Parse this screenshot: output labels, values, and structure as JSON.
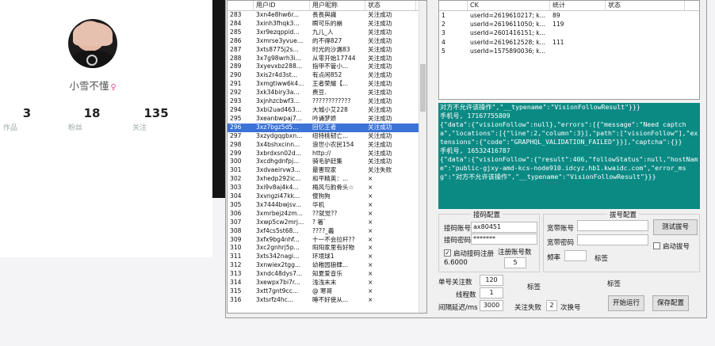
{
  "profile": {
    "username": "小雪不懂",
    "gender_symbol": "♀",
    "stats": [
      {
        "value": "3",
        "label": "作品"
      },
      {
        "value": "18",
        "label": "粉丝"
      },
      {
        "value": "135",
        "label": "关注"
      }
    ]
  },
  "left_table": {
    "columns": [
      "",
      "用户ID",
      "用户昵称",
      "状态"
    ],
    "rows": [
      [
        "283",
        "3xn4e8hw6r...",
        "長長與識",
        "关注成功"
      ],
      [
        "284",
        "3xinh3fhqk3...",
        "瞬可乐的崩",
        "关注成功"
      ],
      [
        "285",
        "3xr9ezqppid...",
        "九儿_人",
        "关注成功"
      ],
      [
        "286",
        "3xmrse3yvue...",
        "的不得827",
        "关注成功"
      ],
      [
        "287",
        "3xts8775j2s...",
        "时光的沙漏83",
        "关注成功"
      ],
      [
        "288",
        "3x7g98wrh3i...",
        "从零开始17744",
        "关注成功"
      ],
      [
        "289",
        "3xyevxbz288...",
        "指甲不管小...",
        "关注成功"
      ],
      [
        "290",
        "3xis2r4d3st...",
        "有点闲852",
        "关注成功"
      ],
      [
        "291",
        "3xmgtiww6k4...",
        "王者荣耀【...",
        "关注成功"
      ],
      [
        "292",
        "3xk34biry3a...",
        "费豆.",
        "关注成功"
      ],
      [
        "293",
        "3xjnhzcbwf3...",
        "????????????",
        "关注成功"
      ],
      [
        "294",
        "3xbi2uad463...",
        "大城小艾228",
        "关注成功"
      ],
      [
        "295",
        "3xeanbwpaj7...",
        "吟诵梦娇",
        "关注成功"
      ],
      [
        "296",
        "3xz7bgz5d5...",
        "回忆王者",
        "关注成功"
      ],
      [
        "297",
        "3xzydgqgbxn...",
        "纽特桃韧亡...",
        "关注成功"
      ],
      [
        "298",
        "3x4bshxcinn...",
        "浪世小农民154",
        "关注成功"
      ],
      [
        "299",
        "3xbrdxsn02d...",
        "http://",
        "关注成功"
      ],
      [
        "300",
        "3xcdhgdnfpj...",
        "骑毛驴赶集",
        "关注成功"
      ],
      [
        "301",
        "3xdvaeirvw3...",
        "最害现家",
        "关注失败"
      ],
      [
        "302",
        "3xhedp292ic...",
        "和平精英：...",
        "×"
      ],
      [
        "303",
        "3xi9v8aj4k4...",
        "梅风与韵骨头☆",
        "×"
      ],
      [
        "304",
        "3xvngzi47kk...",
        "傻狗狗",
        "×"
      ],
      [
        "305",
        "3x7444bwjsv...",
        "华机",
        "×"
      ],
      [
        "306",
        "3xmrbejz4zm...",
        "??就觉??",
        "×"
      ],
      [
        "307",
        "3xwp5cw2mrj...",
        "?  箸`",
        "×"
      ],
      [
        "308",
        "3xf4cs5st68...",
        "????_義",
        "×"
      ],
      [
        "309",
        "3xfx9bg4nhf...",
        "十一不会拉杆??",
        "×"
      ],
      [
        "310",
        "3xc2gnhrj5p...",
        "阳阳家里有好物",
        "×"
      ],
      [
        "311",
        "3xts342nagi...",
        "环境球1",
        "×"
      ],
      [
        "312",
        "3xnwiex2tgg...",
        "幼稚园狼肆...",
        "×"
      ],
      [
        "313",
        "3xndc48dys7...",
        "知夏爱音乐",
        "×"
      ],
      [
        "314",
        "3xewpx7bi7r...",
        "浅浅末末",
        "×"
      ],
      [
        "315",
        "3xtt7gnt9cc...",
        "@  寒哥",
        "×"
      ],
      [
        "316",
        "3xtsrfz4hc...",
        "睡不好使从...",
        "×"
      ]
    ],
    "selected_row": "296"
  },
  "right_table": {
    "columns": [
      "",
      "CK",
      "统计",
      "状态"
    ],
    "rows": [
      [
        "1",
        "userId=2619610217; k...",
        "89",
        ""
      ],
      [
        "2",
        "userId=2619611050; k...",
        "119",
        ""
      ],
      [
        "3",
        "userId=2601416151; k...",
        "",
        ""
      ],
      [
        "4",
        "userId=2619612528; k...",
        "111",
        ""
      ],
      [
        "5",
        "userId=1575890036; k...",
        "",
        ""
      ]
    ]
  },
  "log_text": "对方不允许该操作\",\"__typename\":\"VisionFollowResult\"}}}\n手机号, 17167755809\n{\"data\":{\"visionFollow\":null},\"errors\":[{\"message\":\"Need captcha\",\"locations\":[{\"line\":2,\"column\":3}],\"path\":[\"visionFollow\"],\"extensions\":{\"code\":\"GRAPHQL_VALIDATION_FAILED\"}}],\"captcha\":{}}\n手机号, 16532416787\n{\"data\":{\"visionFollow\":{\"result\":406,\"followStatus\":null,\"hostName\":\"public-gjxy-amd-kcs-node910.idcyz.hb1.kwaidc.com\",\"error_msg\":\"对方不允许该操作\",\"__typename\":\"VisionFollowResult\"}}}",
  "code_config": {
    "title": "接码配置",
    "account_label": "接码账号",
    "account_value": "ax80451",
    "password_label": "接码密码",
    "password_value": "*******",
    "auto_register_label": "启动接码注册",
    "auto_register_checked": true,
    "register_count_label": "注册账号数",
    "register_count_value": "5",
    "balance_value": "6.6000"
  },
  "dial_config": {
    "title": "拔号配置",
    "account_label": "宽带账号",
    "account_value": "",
    "password_label": "宽带密码",
    "password_value": "",
    "freq_label": "频率",
    "freq_value": "",
    "tag_label": "标签",
    "test_button": "测试拔号",
    "enable_label": "启动拔号",
    "enable_checked": false
  },
  "bottom": {
    "follow_count_label": "单号关注数",
    "follow_count_value": "120",
    "threads_label": "线程数",
    "threads_value": "1",
    "interval_label": "间隔延迟/ms",
    "interval_value": "3000",
    "tag1_label": "标签",
    "tag2_label": "标签",
    "fail_label": "关注失败",
    "fail_value": "2",
    "switch_label": "次换号",
    "run_button": "开始运行",
    "save_button": "保存配置"
  },
  "colors": {
    "log_bg": "#0b8a84",
    "selected_row": "#3b73d6",
    "gender": "#e05a9a"
  }
}
